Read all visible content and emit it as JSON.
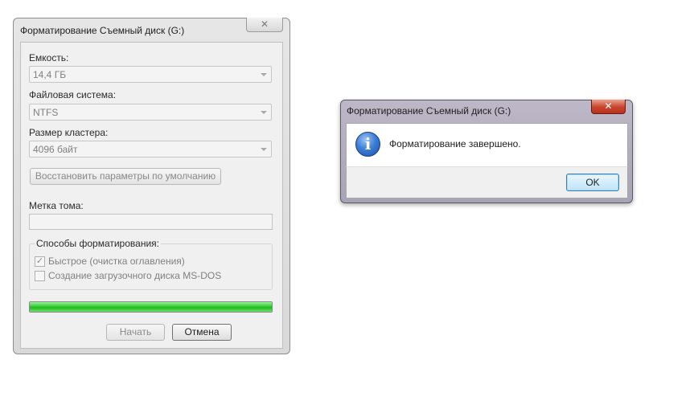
{
  "format_dialog": {
    "title": "Форматирование Съемный диск (G:)",
    "close_glyph": "✕",
    "capacity": {
      "label": "Емкость:",
      "value": "14,4 ГБ"
    },
    "filesystem": {
      "label": "Файловая система:",
      "value": "NTFS"
    },
    "cluster": {
      "label": "Размер кластера:",
      "value": "4096 байт"
    },
    "restore_defaults_label": "Восстановить параметры по умолчанию",
    "volume_label": {
      "label": "Метка тома:",
      "value": ""
    },
    "format_options": {
      "title": "Способы форматирования:",
      "options": [
        {
          "label": "Быстрое (очистка оглавления)",
          "checked": true
        },
        {
          "label": "Создание загрузочного диска MS-DOS",
          "checked": false
        }
      ]
    },
    "progress": 1.0,
    "progress_color": "#32cd32",
    "start_label": "Начать",
    "cancel_label": "Отмена"
  },
  "message_box": {
    "title": "Форматирование Съемный диск (G:)",
    "close_glyph": "✕",
    "icon": "information-icon",
    "icon_glyph": "i",
    "message": "Форматирование завершено.",
    "ok_label": "OK",
    "close_color": "#c8452e"
  }
}
